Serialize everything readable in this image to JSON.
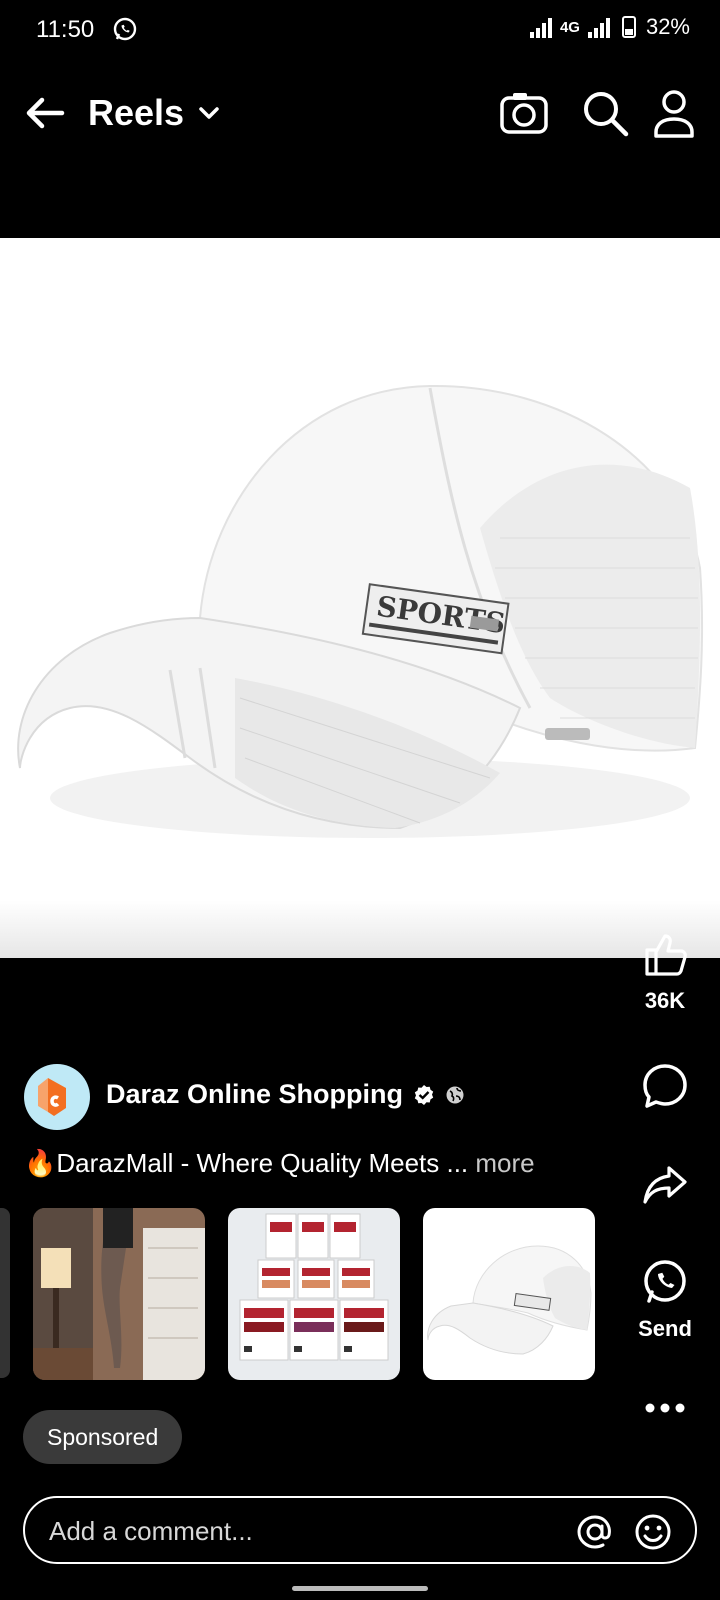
{
  "status_bar": {
    "time": "11:50",
    "network": "4G",
    "battery": "32%"
  },
  "header": {
    "title": "Reels"
  },
  "actions": {
    "likes": "36K",
    "send_label": "Send"
  },
  "post": {
    "page_name": "Daraz Online Shopping",
    "caption": "🔥DarazMall - Where Quality Meets ...",
    "more_label": "more",
    "sponsored_label": "Sponsored"
  },
  "product": {
    "cap_text": "SPORTS"
  },
  "comment": {
    "placeholder": "Add a comment..."
  },
  "colors": {
    "background": "#000000",
    "brand_orange": "#f36f21",
    "avatar_bg": "#bfe9f6"
  }
}
